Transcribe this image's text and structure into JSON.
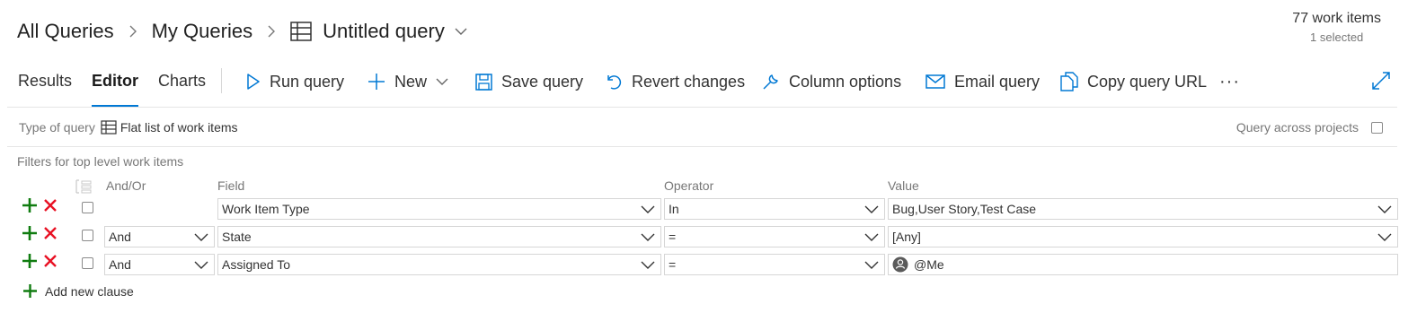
{
  "breadcrumb": {
    "root": "All Queries",
    "folder": "My Queries",
    "query": "Untitled query"
  },
  "summary": {
    "count": "77 work items",
    "selected": "1 selected"
  },
  "tabs": [
    "Results",
    "Editor",
    "Charts"
  ],
  "active_tab": "Editor",
  "toolbar": {
    "run": "Run query",
    "new": "New",
    "save": "Save query",
    "revert": "Revert changes",
    "columns": "Column options",
    "email": "Email query",
    "copy": "Copy query URL",
    "more": "···"
  },
  "query_type": {
    "label": "Type of query",
    "value": "Flat list of work items"
  },
  "across_projects": "Query across projects",
  "filters_title": "Filters for top level work items",
  "columns": {
    "andor": "And/Or",
    "field": "Field",
    "operator": "Operator",
    "value": "Value"
  },
  "clauses": [
    {
      "andor": "",
      "field": "Work Item Type",
      "operator": "In",
      "value": "Bug,User Story,Test Case"
    },
    {
      "andor": "And",
      "field": "State",
      "operator": "=",
      "value": "[Any]"
    },
    {
      "andor": "And",
      "field": "Assigned To",
      "operator": "=",
      "value": "@Me"
    }
  ],
  "add_clause": "Add new clause",
  "colors": {
    "accent": "#0078d4",
    "add": "#107c10",
    "remove": "#e81123"
  }
}
